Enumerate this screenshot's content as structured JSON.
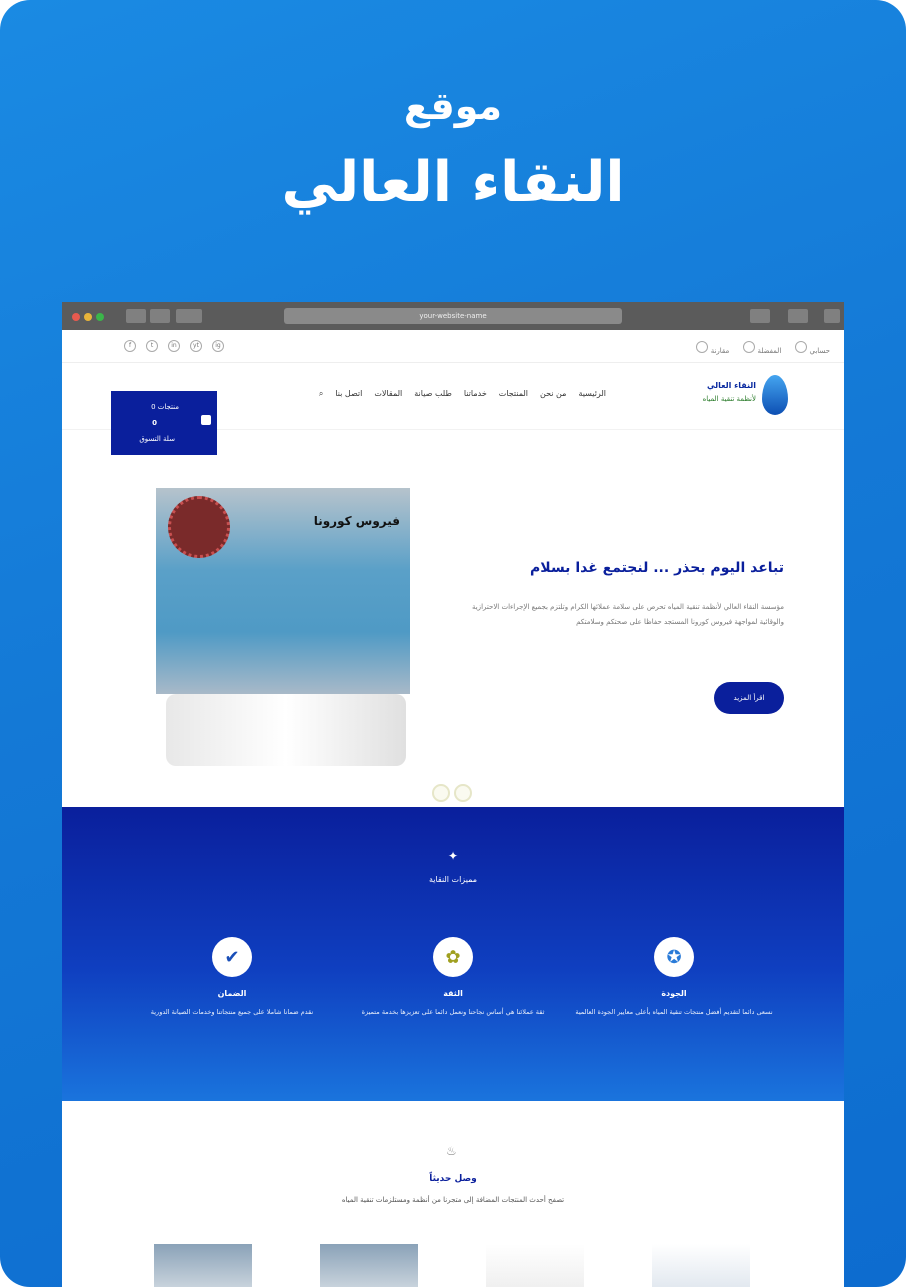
{
  "hero": {
    "line1": "موقع",
    "line2": "النقاء العالي"
  },
  "browser": {
    "url": "your-website-name"
  },
  "topbar": {
    "right": [
      "حسابي",
      "المفضلة",
      "مقارنة"
    ],
    "left": [
      "f",
      "t",
      "in",
      "yt",
      "ig"
    ]
  },
  "cart": {
    "label": "0 منتجات",
    "count": "0",
    "sub": "سلة التسوق"
  },
  "menu": [
    "الرئيسية",
    "من نحن",
    "المنتجات",
    "خدماتنا",
    "طلب صيانة",
    "المقالات",
    "اتصل بنا",
    "بحث"
  ],
  "logo": {
    "name": "النقاء العالي",
    "tagline": "لأنظمة تنقية المياه"
  },
  "slide": {
    "image_title": "فيروس كورونا",
    "heading": "تباعد اليوم بحذر ... لنجتمع غدا بسلام",
    "paragraph": "مؤسسة النقاء العالي لأنظمة تنقية المياه تحرص على سلامة عملائها الكرام وتلتزم بجميع الإجراءات الاحترازية والوقائية لمواجهة فيروس كورونا المستجد حفاظا على صحتكم وسلامتكم",
    "button": "اقرأ المزيد"
  },
  "features": {
    "title": "مميزات النقاية",
    "items": [
      {
        "icon": "quality-icon",
        "title": "الجودة",
        "desc": "نسعى دائما لتقديم أفضل منتجات تنقية المياه بأعلى معايير الجودة العالمية"
      },
      {
        "icon": "trust-icon",
        "title": "الثقة",
        "desc": "ثقة عملائنا هي أساس نجاحنا ونعمل دائما على تعزيزها بخدمة متميزة"
      },
      {
        "icon": "guarantee-icon",
        "title": "الضمان",
        "desc": "نقدم ضمانا شاملا على جميع منتجاتنا وخدمات الصيانة الدورية"
      }
    ]
  },
  "products": {
    "title": "وصل حديثاً",
    "subtitle": "تصفح أحدث المنتجات المضافة إلى متجرنا من أنظمة ومستلزمات تنقية المياه"
  },
  "colors": {
    "brand": "#0a1f9c",
    "background": "#1479d6"
  }
}
